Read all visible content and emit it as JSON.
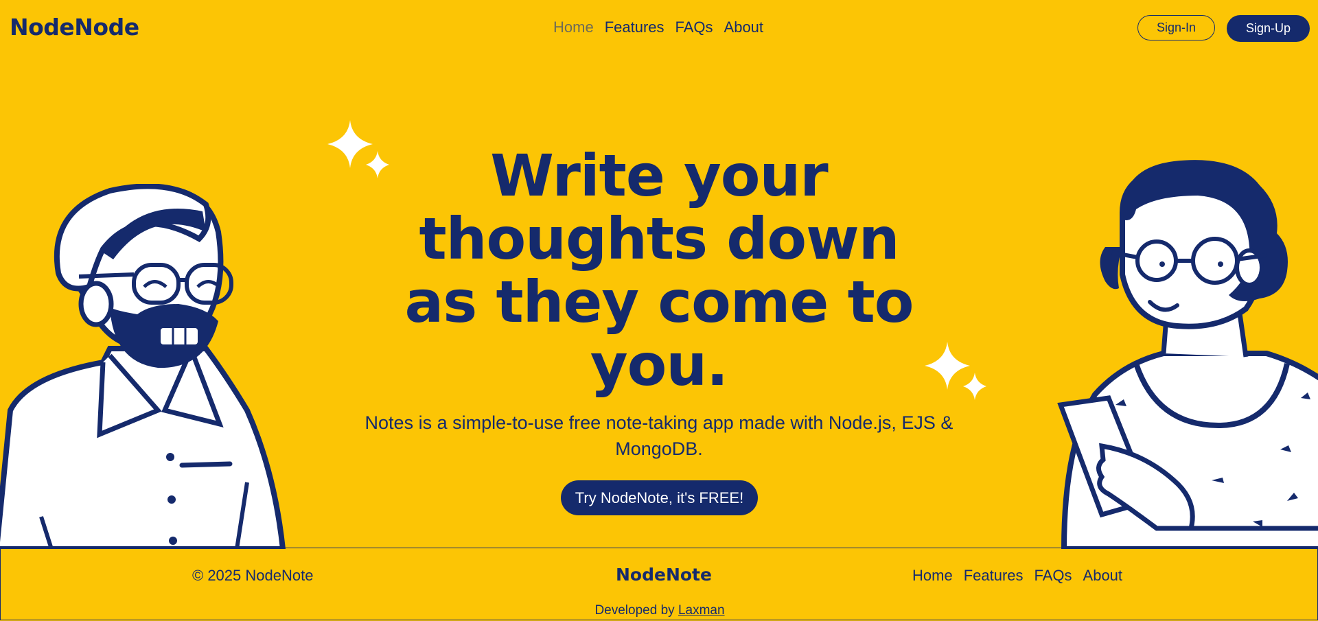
{
  "nav": {
    "logo": "NodeNode",
    "links": [
      "Home",
      "Features",
      "FAQs",
      "About"
    ],
    "active": "Home",
    "signin": "Sign-In",
    "signup": "Sign-Up"
  },
  "hero": {
    "title": "Write your thoughts down as they come to you.",
    "subtitle": "Notes is a simple-to-use free note-taking app made with Node.js, EJS & MongoDB.",
    "cta": "Try NodeNote, it's FREE!"
  },
  "footer": {
    "copyright": "© 2025 NodeNote",
    "logo": "NodeNote",
    "links": [
      "Home",
      "Features",
      "FAQs",
      "About"
    ],
    "developed_prefix": "Developed by",
    "developer": "Laxman"
  },
  "colors": {
    "background": "#fcc505",
    "primary": "#152a6c",
    "inactive_nav": "#6d6b58",
    "white": "#ffffff"
  },
  "icons": [
    "sparkle-icon",
    "man-illustration",
    "woman-illustration"
  ]
}
